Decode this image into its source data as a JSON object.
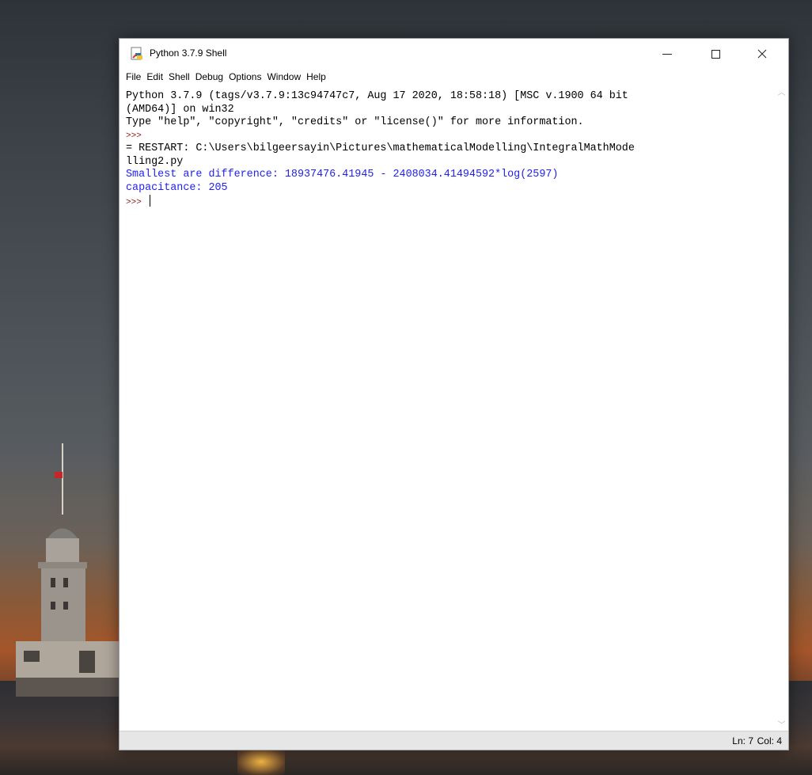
{
  "window": {
    "title": "Python 3.7.9 Shell",
    "minimize_glyph": "—",
    "maximize_glyph": "☐",
    "close_glyph": "✕"
  },
  "menu": {
    "items": [
      "File",
      "Edit",
      "Shell",
      "Debug",
      "Options",
      "Window",
      "Help"
    ]
  },
  "shell": {
    "lines": [
      {
        "type": "text",
        "text": "Python 3.7.9 (tags/v3.7.9:13c94747c7, Aug 17 2020, 18:58:18) [MSC v.1900 64 bit"
      },
      {
        "type": "text",
        "text": "(AMD64)] on win32"
      },
      {
        "type": "text",
        "text": "Type \"help\", \"copyright\", \"credits\" or \"license()\" for more information."
      },
      {
        "type": "prompt",
        "text": ">>>"
      },
      {
        "type": "text",
        "text": "= RESTART: C:\\Users\\bilgeersayin\\Pictures\\mathematicalModelling\\IntegralMathMode"
      },
      {
        "type": "text",
        "text": "lling2.py"
      },
      {
        "type": "stdout",
        "text": "Smallest are difference: 18937476.41945 - 2408034.41494592*log(2597)"
      },
      {
        "type": "stdout",
        "text": "capacitance: 205"
      }
    ],
    "active_prompt": ">>>"
  },
  "status": {
    "ln": "Ln: 7",
    "col": "Col: 4"
  },
  "scrollbar": {
    "up_glyph": "︿",
    "down_glyph": "﹀"
  },
  "colors": {
    "prompt": "#8a1414",
    "stdout": "#2222ee",
    "text": "#000000",
    "statusbar": "#e6e6e6"
  }
}
